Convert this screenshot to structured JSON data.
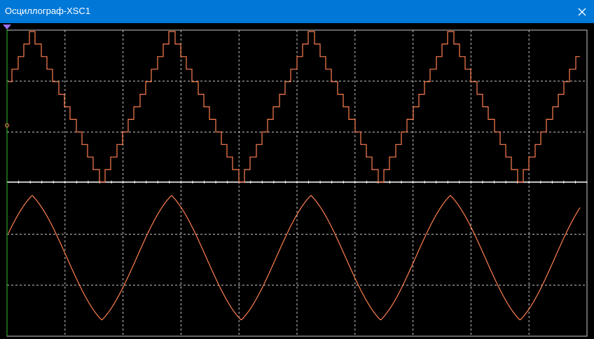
{
  "window": {
    "title": "Осциллограф-XSC1",
    "close_icon": "close-icon"
  },
  "colors": {
    "titlebar": "#0078d7",
    "screen_background": "#000000",
    "grid": "#c8c8c8",
    "trace": "#ff7f50",
    "cursor": "#2fbf2f",
    "cursor_marker": "#a070ff",
    "baseline": "#ffffff"
  },
  "screen": {
    "grid_columns": 10,
    "grid_rows": 6,
    "trace_a": {
      "waveform": "stepped-triangle",
      "periods_visible": 4.1,
      "steps_per_half_period": 12
    },
    "trace_b": {
      "waveform": "smoothed-triangle",
      "periods_visible": 4.1
    }
  }
}
